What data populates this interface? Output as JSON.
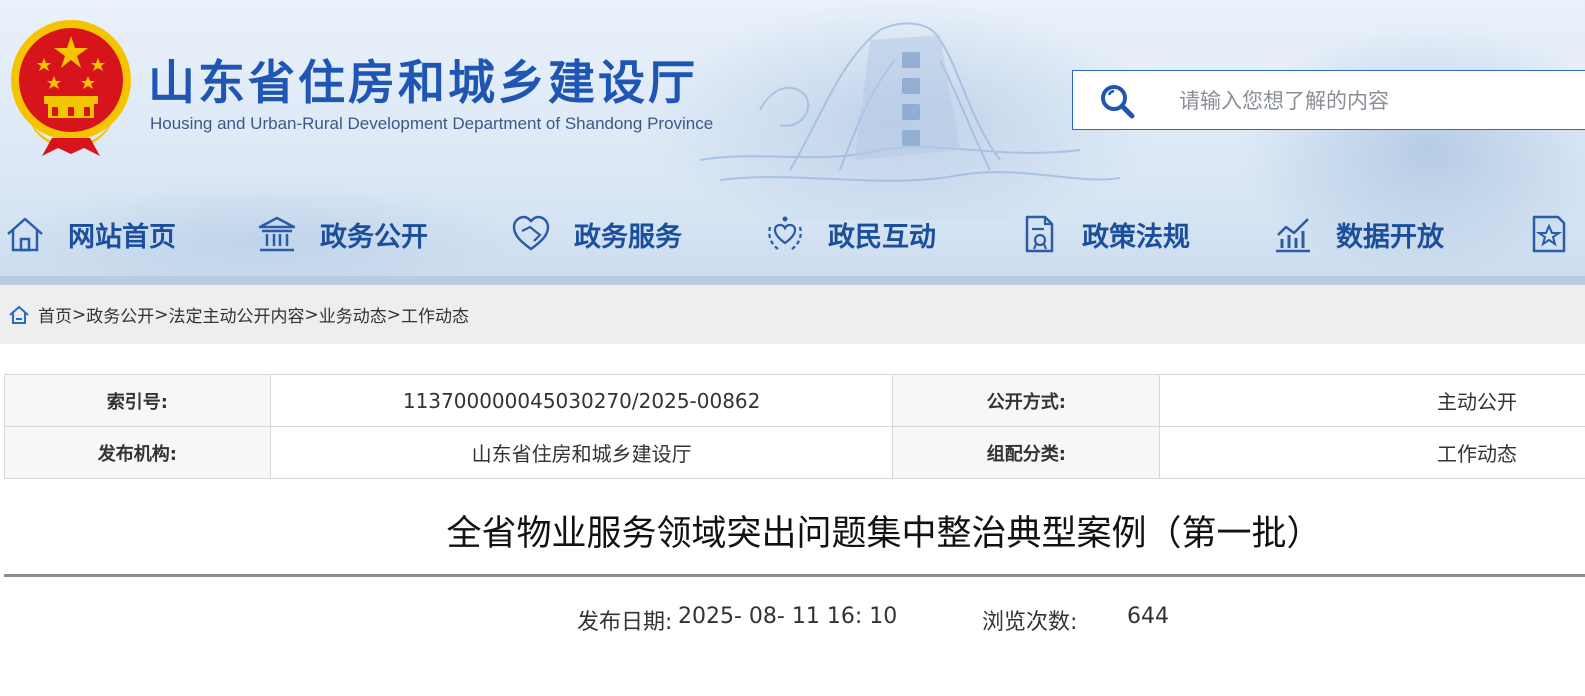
{
  "header": {
    "site_title": "山东省住房和城乡建设厅",
    "site_subtitle": "Housing and Urban-Rural Development Department of Shandong Province",
    "emblem_icon": "national-emblem",
    "search": {
      "placeholder": "请输入您想了解的内容",
      "icon": "search-icon"
    }
  },
  "nav": {
    "items": [
      {
        "label": "网站首页",
        "icon": "home-icon"
      },
      {
        "label": "政务公开",
        "icon": "government-building-icon"
      },
      {
        "label": "政务服务",
        "icon": "handshake-heart-icon"
      },
      {
        "label": "政民互动",
        "icon": "heart-hands-icon"
      },
      {
        "label": "政策法规",
        "icon": "document-icon"
      },
      {
        "label": "数据开放",
        "icon": "chart-icon"
      }
    ],
    "partial_item_icon": "star-document-icon"
  },
  "breadcrumb": {
    "icon": "home-icon",
    "items": [
      "首页",
      "政务公开",
      "法定主动公开内容",
      "业务动态",
      "工作动态"
    ],
    "separator": ">"
  },
  "info": {
    "index_label": "索引号:",
    "index_value": "11370000004503027​0/2025-00862",
    "open_mode_label": "公开方式:",
    "open_mode_value": "主动公开",
    "publisher_label": "发布机构:",
    "publisher_value": "山东省住房和城乡建设厅",
    "category_label": "组配分类:",
    "category_value": "工作动态"
  },
  "article": {
    "title": "全省物业服务领域突出问题集中整治典型案例（第一批）",
    "date_label": "发布日期:",
    "date_value": "2025- 08- 11 16: 10",
    "views_label": "浏览次数:",
    "views_value": "644"
  },
  "colors": {
    "brand_blue": "#1f56b4",
    "nav_text": "#1b4f9c",
    "search_border": "#2f68c2",
    "breadcrumb_bg": "#eeeeee",
    "emblem_red": "#d7131c",
    "emblem_gold": "#f5c400"
  }
}
